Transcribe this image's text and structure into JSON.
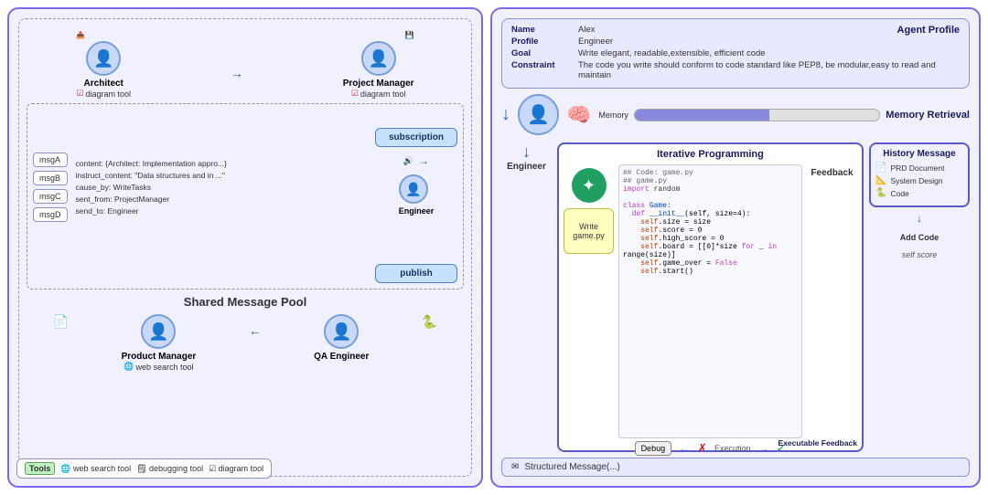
{
  "left": {
    "title": "Shared Message Pool",
    "architect": {
      "name": "Architect",
      "tool": "diagram tool",
      "avatar": "👤"
    },
    "project_manager": {
      "name": "Project Manager",
      "tool": "diagram tool",
      "avatar": "👤"
    },
    "engineer": {
      "name": "Engineer",
      "avatar": "👤"
    },
    "product_manager": {
      "name": "Product Manager",
      "tool": "web search tool",
      "avatar": "👤"
    },
    "qa_engineer": {
      "name": "QA Engineer",
      "avatar": "👤"
    },
    "messages": [
      "msgA",
      "msgB",
      "msgC",
      "msgD"
    ],
    "msg_content": {
      "line1": "content: {Architect: Implementation appro...}",
      "line2": "instruct_content: \"Data structures and in ...\"",
      "line3": "cause_by: WriteTasks",
      "line4": "sent_from: ProjectManager",
      "line5": "send_to: Engineer"
    },
    "subscription": "subscription",
    "publish": "publish",
    "tools_legend": {
      "label": "Tools",
      "items": "🌐 web search tool  🗒 debugging tool  ☑ diagram tool"
    }
  },
  "right": {
    "profile": {
      "title": "Agent Profile",
      "fields": [
        {
          "key": "Name",
          "value": "Alex"
        },
        {
          "key": "Profile",
          "value": "Engineer"
        },
        {
          "key": "Goal",
          "value": "Write elegant, readable,extensible, efficient code"
        },
        {
          "key": "Constraint",
          "value": "The code you write should conform to code standard like PEP8, be modular,easy to read and maintain"
        }
      ]
    },
    "memory": {
      "label": "Memory",
      "retrieval_label": "Memory Retrieval"
    },
    "engineer_label": "Engineer",
    "iterative_title": "Iterative Programming",
    "code": {
      "lines": [
        "## Code: game.py",
        "## game.py",
        "import random",
        "",
        "class Game:",
        "    def __init__(self, size=4):",
        "        self.size = size",
        "        self.score = 0",
        "        self.high_score = 0",
        "        self.board = [[0]*size for _ in",
        "range(size)]",
        "        self.game_over = False",
        "        self.start()"
      ]
    },
    "write_game": "Write\ngame.py",
    "feedback_label": "Feedback",
    "debug_label": "Debug",
    "execution_label": "Execution",
    "executable_feedback": "Executable Feedback",
    "history": {
      "title": "History Message",
      "items": [
        {
          "icon": "📄",
          "label": "PRD Document"
        },
        {
          "icon": "📐",
          "label": "System Design"
        },
        {
          "icon": "🐍",
          "label": "Code"
        }
      ]
    },
    "add_code_label": "Add Code",
    "structured_msg": "Structured Message(...)",
    "self_score": "self score"
  }
}
